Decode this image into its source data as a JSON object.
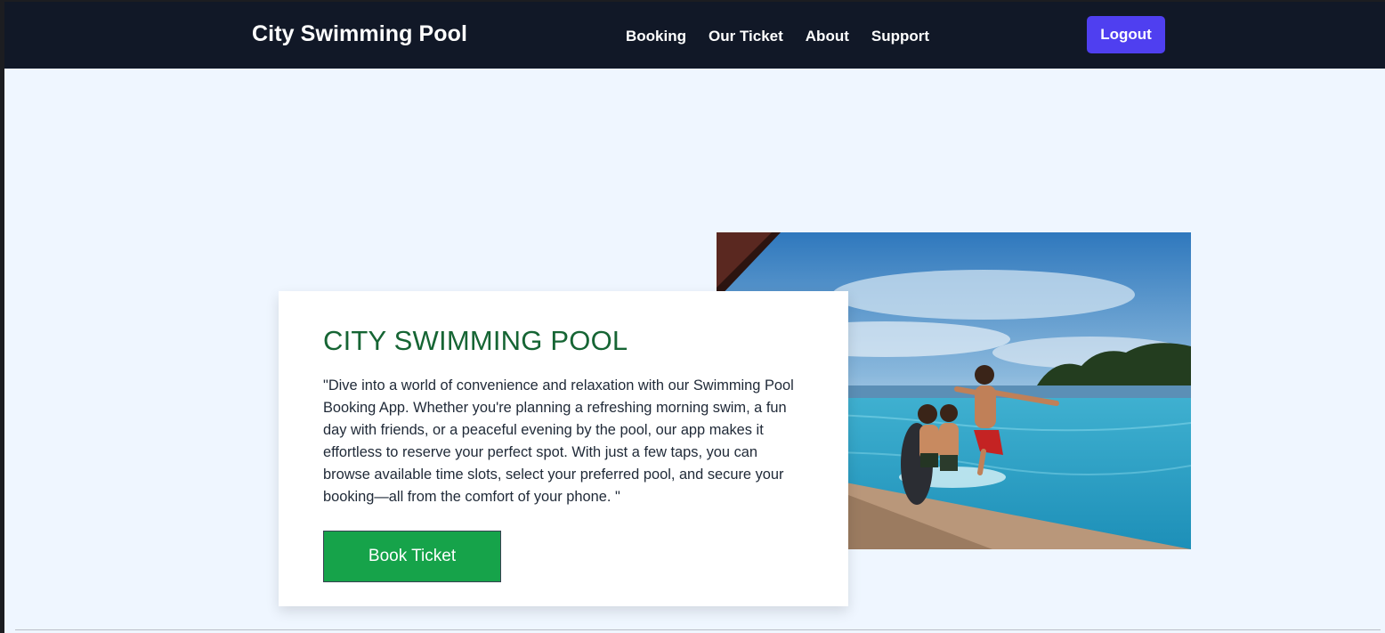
{
  "header": {
    "brand": "City Swimming Pool",
    "nav": [
      "Booking",
      "Our Ticket",
      "About",
      "Support"
    ],
    "logout_label": "Logout"
  },
  "hero": {
    "title": "CITY SWIMMING POOL",
    "description": "\"Dive into a world of convenience and relaxation with our Swimming Pool Booking App. Whether you're planning a refreshing morning swim, a fun day with friends, or a peaceful evening by the pool, our app makes it effortless to reserve your perfect spot. With just a few taps, you can browse available time slots, select your preferred pool, and secure your booking—all from the comfort of your phone. \"",
    "cta_label": "Book Ticket"
  },
  "colors": {
    "navbar": "#111827",
    "page_bg": "#eff6ff",
    "logout": "#4f3ff0",
    "title": "#166534",
    "cta": "#16a34a"
  }
}
